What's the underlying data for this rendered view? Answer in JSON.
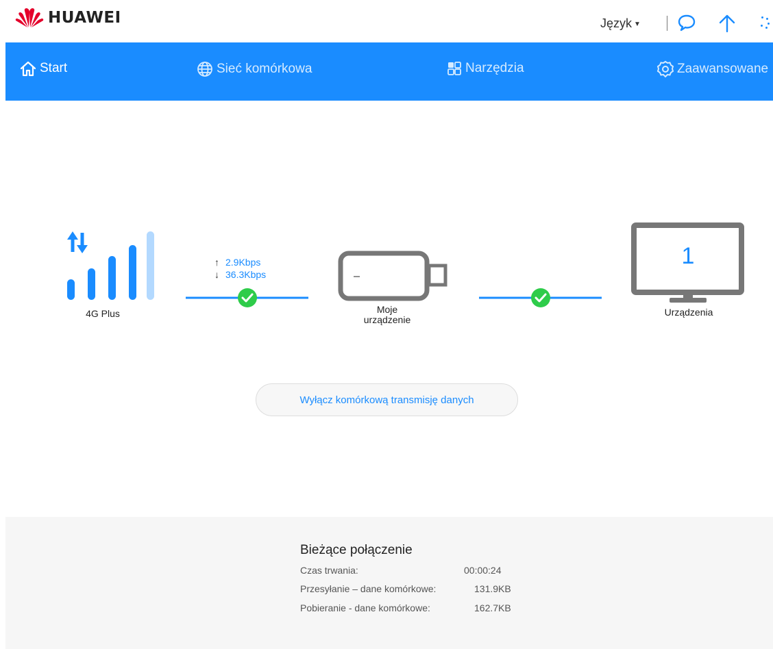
{
  "header": {
    "brand": "HUAWEI",
    "language_label": "Język",
    "icons": [
      "chat-icon",
      "upload-icon",
      "loading-icon"
    ]
  },
  "nav": {
    "items": [
      {
        "label": "Start",
        "icon": "home-icon"
      },
      {
        "label": "Sieć komórkowa",
        "icon": "globe-icon"
      },
      {
        "label": "Narzędzia",
        "icon": "tools-icon"
      },
      {
        "label": "Zaawansowane",
        "icon": "settings-icon"
      }
    ]
  },
  "status": {
    "network_type": "4G  Plus",
    "upload_speed": "2.9Kbps",
    "download_speed": "36.3Kbps",
    "my_device_line1": "Moje",
    "my_device_line2": "urządzenie",
    "device_placeholder": "–",
    "devices_count": "1",
    "devices_label": "Urządzenia",
    "signal_bars": 4,
    "signal_bars_total": 5
  },
  "actions": {
    "toggle_data_label": "Wyłącz komórkową transmisję danych"
  },
  "connection": {
    "title": "Bieżące połączenie",
    "rows": [
      {
        "label": "Czas trwania:",
        "value": "00:00:24"
      },
      {
        "label": "Przesyłanie – dane komórkowe:",
        "value": "131.9KB"
      },
      {
        "label": "Pobieranie - dane komórkowe:",
        "value": "162.7KB"
      }
    ]
  },
  "colors": {
    "accent": "#1a8cff",
    "success": "#2ecc4a",
    "device_gray": "#777777",
    "signal_inactive": "#b3d9ff"
  }
}
